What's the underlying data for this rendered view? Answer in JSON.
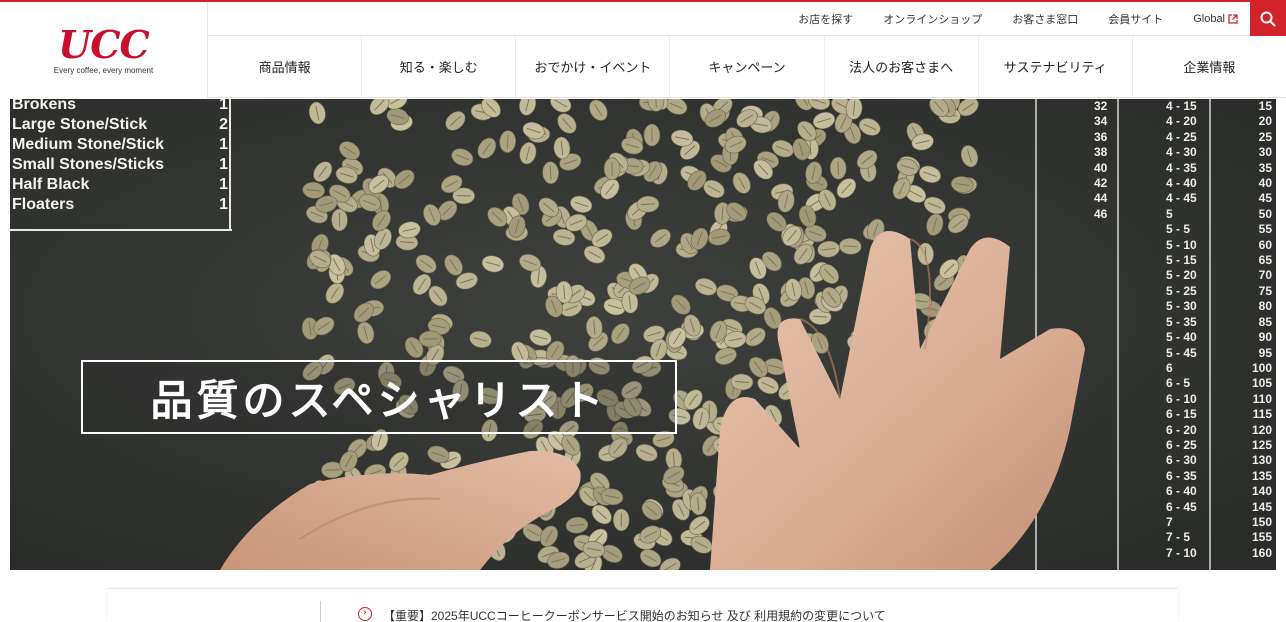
{
  "brand": {
    "logo": "UCC",
    "tagline": "Every coffee, every moment",
    "accent": "#d2232a"
  },
  "util_nav": [
    {
      "label": "お店を探す"
    },
    {
      "label": "オンラインショップ"
    },
    {
      "label": "お客さま窓口"
    },
    {
      "label": "会員サイト"
    },
    {
      "label": "Global",
      "icon": "external-link-icon"
    }
  ],
  "search_icon": "search-icon",
  "main_nav": [
    {
      "label": "商品情報"
    },
    {
      "label": "知る・楽しむ"
    },
    {
      "label": "おでかけ・イベント"
    },
    {
      "label": "キャンペーン"
    },
    {
      "label": "法人のお客さまへ"
    },
    {
      "label": "サステナビリティ"
    },
    {
      "label": "企業情報"
    }
  ],
  "hero": {
    "title": "品質のスペシャリスト",
    "chalk_left": [
      {
        "label": "Brokens",
        "value": "1"
      },
      {
        "label": "Large Stone/Stick",
        "value": "2"
      },
      {
        "label": "Medium Stone/Stick",
        "value": "1"
      },
      {
        "label": "Small Stones/Sticks",
        "value": "1"
      },
      {
        "label": "Half Black",
        "value": "1"
      },
      {
        "label": "Floaters",
        "value": "1"
      }
    ],
    "chalk_right": [
      {
        "a": "32",
        "b": "4 - 15",
        "c": "15"
      },
      {
        "a": "34",
        "b": "4 - 20",
        "c": "20"
      },
      {
        "a": "36",
        "b": "4 - 25",
        "c": "25"
      },
      {
        "a": "38",
        "b": "4 - 30",
        "c": "30"
      },
      {
        "a": "40",
        "b": "4 - 35",
        "c": "35"
      },
      {
        "a": "42",
        "b": "4 - 40",
        "c": "40"
      },
      {
        "a": "44",
        "b": "4 - 45",
        "c": "45"
      },
      {
        "a": "46",
        "b": "5",
        "c": "50"
      },
      {
        "a": "",
        "b": "5 - 5",
        "c": "55"
      },
      {
        "a": "",
        "b": "5 - 10",
        "c": "60"
      },
      {
        "a": "",
        "b": "5 - 15",
        "c": "65"
      },
      {
        "a": "",
        "b": "5 - 20",
        "c": "70"
      },
      {
        "a": "",
        "b": "5 - 25",
        "c": "75"
      },
      {
        "a": "",
        "b": "5 - 30",
        "c": "80"
      },
      {
        "a": "",
        "b": "5 - 35",
        "c": "85"
      },
      {
        "a": "",
        "b": "5 - 40",
        "c": "90"
      },
      {
        "a": "",
        "b": "5 - 45",
        "c": "95"
      },
      {
        "a": "",
        "b": "6",
        "c": "100"
      },
      {
        "a": "",
        "b": "6 - 5",
        "c": "105"
      },
      {
        "a": "",
        "b": "6 - 10",
        "c": "110"
      },
      {
        "a": "",
        "b": "6 - 15",
        "c": "115"
      },
      {
        "a": "",
        "b": "6 - 20",
        "c": "120"
      },
      {
        "a": "",
        "b": "6 - 25",
        "c": "125"
      },
      {
        "a": "",
        "b": "6 - 30",
        "c": "130"
      },
      {
        "a": "",
        "b": "6 - 35",
        "c": "135"
      },
      {
        "a": "",
        "b": "6 - 40",
        "c": "140"
      },
      {
        "a": "",
        "b": "6 - 45",
        "c": "145"
      },
      {
        "a": "",
        "b": "7",
        "c": "150"
      },
      {
        "a": "",
        "b": "7 - 5",
        "c": "155"
      },
      {
        "a": "",
        "b": "7 - 10",
        "c": "160"
      }
    ]
  },
  "notice": {
    "icon": "chevron-right-circle-icon",
    "text": "【重要】2025年UCCコーヒークーポンサービス開始のお知らせ 及び 利用規約の変更について"
  }
}
